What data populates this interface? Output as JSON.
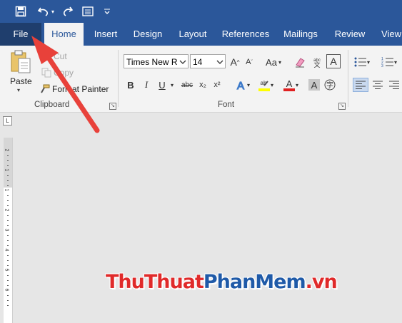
{
  "quick_access": {
    "save_icon": "save-icon",
    "undo_icon": "undo-icon",
    "redo_icon": "redo-icon",
    "customize_icon": "customize-icon"
  },
  "tabs": [
    {
      "label": "File"
    },
    {
      "label": "Home"
    },
    {
      "label": "Insert"
    },
    {
      "label": "Design"
    },
    {
      "label": "Layout"
    },
    {
      "label": "References"
    },
    {
      "label": "Mailings"
    },
    {
      "label": "Review"
    },
    {
      "label": "View"
    }
  ],
  "clipboard": {
    "paste_label": "Paste",
    "cut_label": "Cut",
    "copy_label": "Copy",
    "format_painter_label": "Format Painter",
    "group_label": "Clipboard"
  },
  "font": {
    "font_name": "Times New R",
    "font_size": "14",
    "change_case_label": "Aa",
    "group_label": "Font",
    "bold": "B",
    "italic": "I",
    "underline": "U",
    "strikethrough": "abc",
    "subscript": "x₂",
    "superscript": "x²"
  },
  "watermark": {
    "part1": "ThuThuat",
    "part2": "PhanMem",
    "part3": ".vn"
  },
  "colors": {
    "ribbon_blue": "#2b579a",
    "file_tab": "#1f3e6d",
    "arrow_red": "#e8413a",
    "watermark_red": "#e02a2a",
    "watermark_blue": "#1f5aa8"
  }
}
